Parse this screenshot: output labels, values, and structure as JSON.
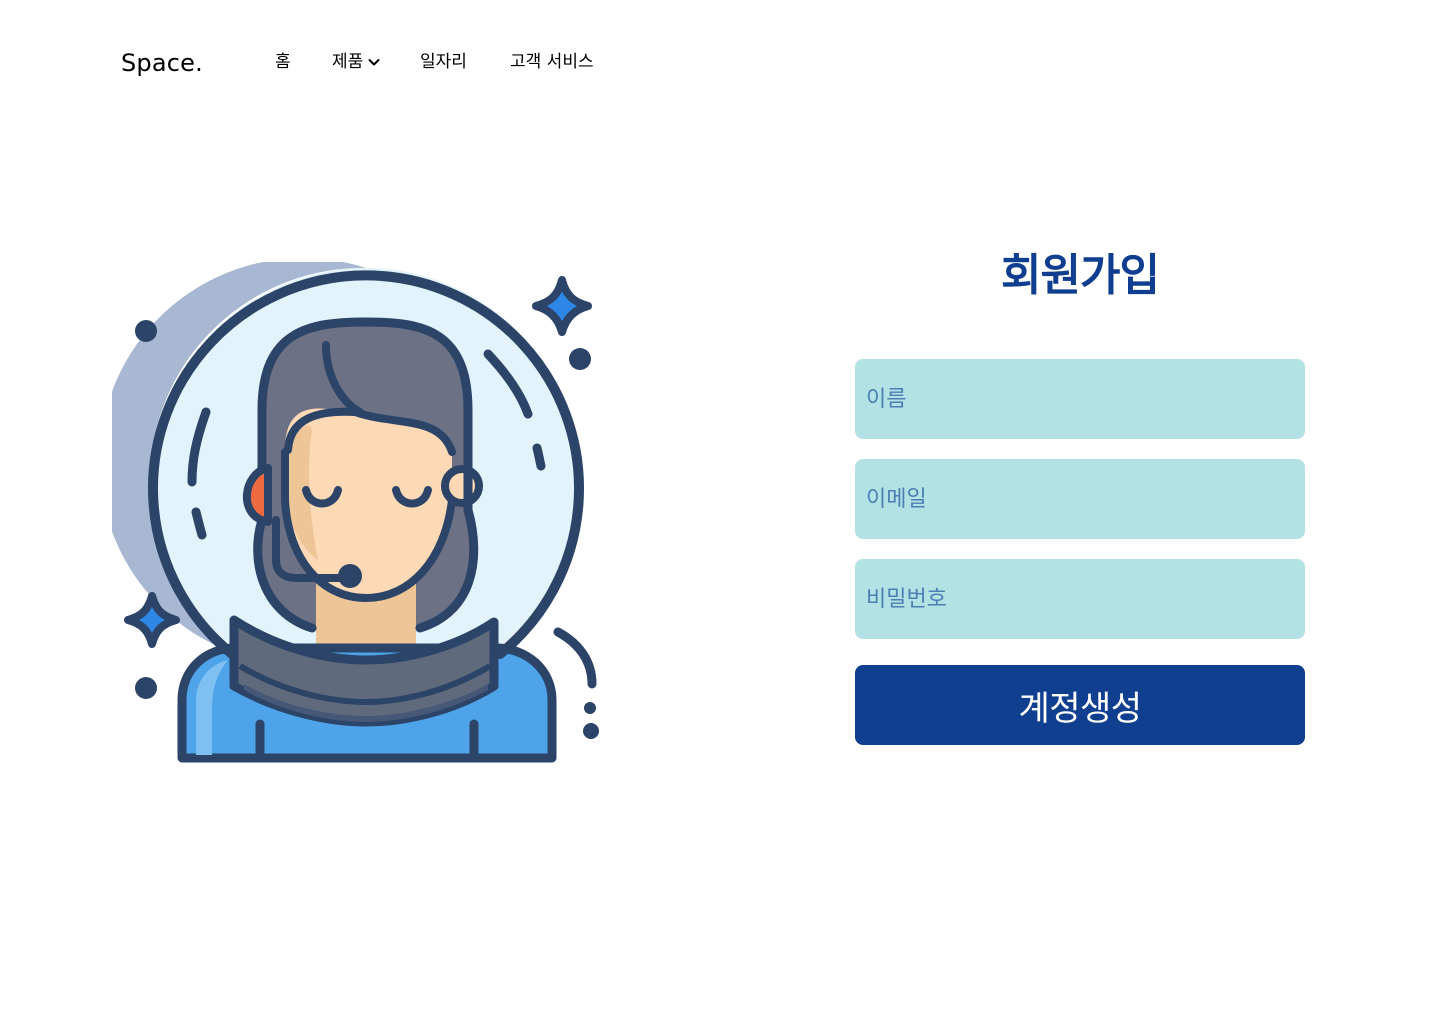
{
  "nav": {
    "logo": "Space.",
    "items": [
      {
        "label": "홈"
      },
      {
        "label": "제품",
        "has_dropdown": true
      },
      {
        "label": "일자리"
      },
      {
        "label": "고객 서비스"
      }
    ]
  },
  "signup": {
    "title": "회원가입",
    "fields": [
      {
        "placeholder": "이름",
        "value": ""
      },
      {
        "placeholder": "이메일",
        "value": ""
      },
      {
        "placeholder": "비밀번호",
        "value": ""
      }
    ],
    "submit_label": "계정생성"
  },
  "illustration": {
    "icon": "astronaut-support-agent-icon"
  },
  "colors": {
    "primary": "#103f8f",
    "field_bg": "#b3e2e5",
    "placeholder": "#4a7fb3",
    "outline": "#2b4468"
  }
}
